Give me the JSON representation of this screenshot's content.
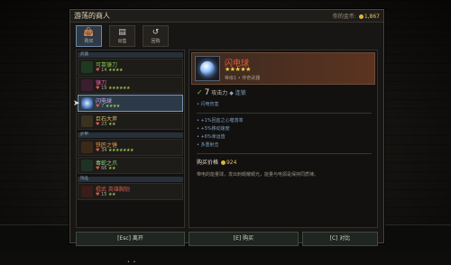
{
  "window": {
    "title": "游荡的商人",
    "gold_label": "你的金币:",
    "gold_value": "1,867"
  },
  "tabs": [
    {
      "icon": "bag-icon",
      "glyph": "👜",
      "label": "购买"
    },
    {
      "icon": "sell-icon",
      "glyph": "▤",
      "label": "出售"
    },
    {
      "icon": "buyback-icon",
      "glyph": "↺",
      "label": "回购"
    }
  ],
  "sections": [
    "武器",
    "护甲",
    "饰品"
  ],
  "items": [
    {
      "name": "可靠镰刀",
      "value": "14",
      "stars": "★★★★",
      "color": "#7fc24a"
    },
    {
      "name": "镰刀",
      "value": "19",
      "stars": "★★★★★★",
      "color": "#e25d9c"
    },
    {
      "name": "闪电球",
      "value": "7",
      "stars": "★★★★",
      "color": "#b69ce8"
    },
    {
      "name": "巨石大斧",
      "value": "23",
      "stars": "★★",
      "color": "#e0c36a"
    },
    {
      "name": "铁匠之锤",
      "value": "34",
      "stars": "★★★★★★★",
      "color": "#e89a4a"
    },
    {
      "name": "毒蛇之爪",
      "value": "66",
      "stars": "★★",
      "color": "#8fd28a"
    },
    {
      "name": "棍武 英雄胸铠",
      "value": "15",
      "stars": "★★",
      "color": "#e05a48"
    }
  ],
  "detail": {
    "name": "闪电球",
    "stars": "★★★★★",
    "type": "等级1 • 传奇武器",
    "attack_value": "7",
    "attack_label": "攻击力",
    "attack_tag": "◆ 连锁",
    "effect": "闪电伤害",
    "bullets": [
      "+1%回血之心噬落率",
      "+5%移动速度",
      "+6%幸运值",
      "多重射击"
    ],
    "price_label": "购买价格",
    "price": "924",
    "description": "带电的能量球，发出刺眼耀眼光，能量与电源是保持同质律。"
  },
  "buttons": {
    "leave": "[Esc] 离开",
    "buy": "[E] 购买",
    "compare": "[C] 对比"
  }
}
